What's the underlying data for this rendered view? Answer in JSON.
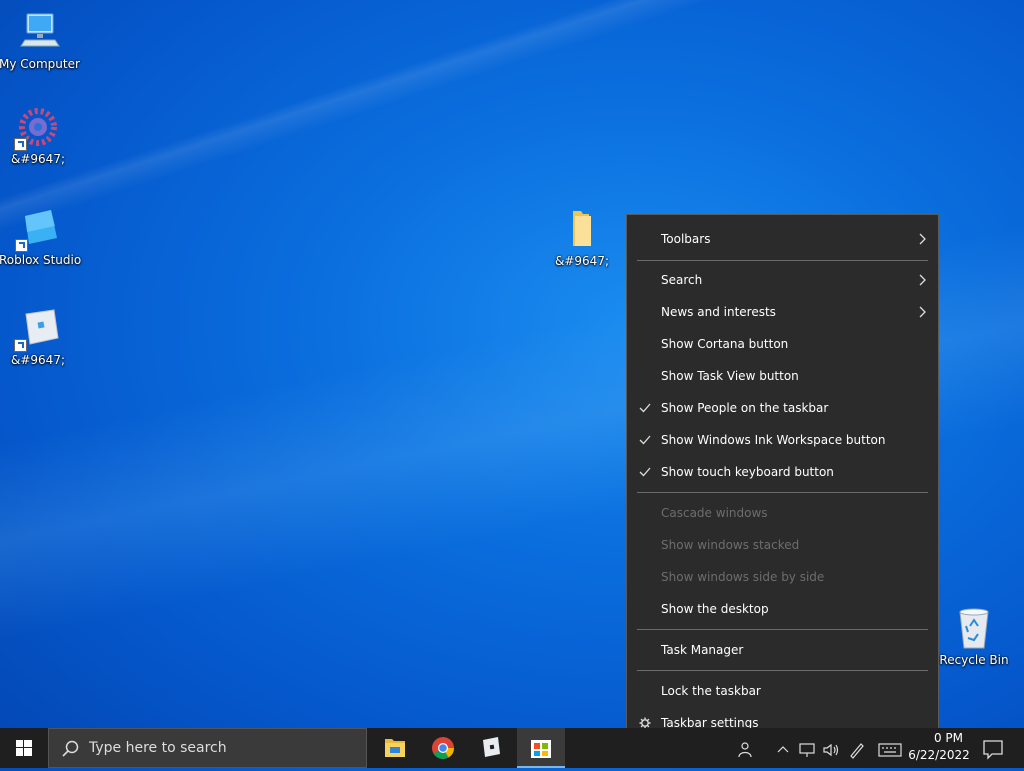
{
  "desktop": {
    "icons": [
      {
        "label": "My Computer"
      },
      {
        "label": "&#9647;"
      },
      {
        "label": "Roblox Studio"
      },
      {
        "label": "&#9647;"
      },
      {
        "label": "&#9647;"
      },
      {
        "label": "Recycle Bin"
      }
    ]
  },
  "context_menu": {
    "items": [
      {
        "label": "Toolbars"
      },
      {
        "label": "Search"
      },
      {
        "label": "News and interests"
      },
      {
        "label": "Show Cortana button"
      },
      {
        "label": "Show Task View button"
      },
      {
        "label": "Show People on the taskbar"
      },
      {
        "label": "Show Windows Ink Workspace button"
      },
      {
        "label": "Show touch keyboard button"
      },
      {
        "label": "Cascade windows"
      },
      {
        "label": "Show windows stacked"
      },
      {
        "label": "Show windows side by side"
      },
      {
        "label": "Show the desktop"
      },
      {
        "label": "Task Manager"
      },
      {
        "label": "Lock the taskbar"
      },
      {
        "label": "Taskbar settings"
      }
    ]
  },
  "taskbar": {
    "search_placeholder": "Type here to search",
    "apps": [
      "file-explorer-icon",
      "chrome-icon",
      "roblox-icon",
      "microsoft-store-icon"
    ],
    "clock": {
      "time": "0 PM",
      "date": "6/22/2022"
    }
  },
  "colors": {
    "menu_bg": "#2b2b2b",
    "desktop": "#0b6fde",
    "taskbar": "#1f1f1f"
  }
}
